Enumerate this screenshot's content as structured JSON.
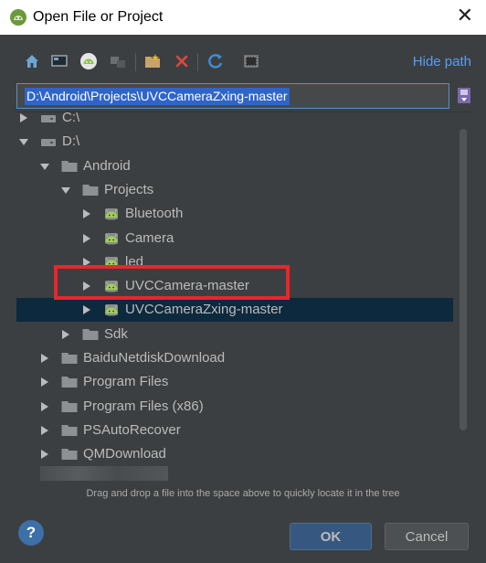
{
  "window": {
    "title": "Open File or Project",
    "close_glyph": "✕"
  },
  "toolbar": {
    "buttons": [
      {
        "name": "home-icon"
      },
      {
        "name": "desktop-icon"
      },
      {
        "name": "project-icon"
      },
      {
        "name": "module-icon"
      },
      {
        "name": "new-folder-icon"
      },
      {
        "name": "delete-icon"
      },
      {
        "name": "refresh-icon"
      },
      {
        "name": "show-hidden-icon"
      }
    ],
    "hide_path_label": "Hide path"
  },
  "path_field": {
    "value": "D:\\Android\\Projects\\UVCCameraZxing-master"
  },
  "tree": {
    "rows": [
      {
        "label": "C:\\",
        "depth": 1,
        "icon": "drive-icon",
        "arrow": "right",
        "selected": false
      },
      {
        "label": "D:\\",
        "depth": 1,
        "icon": "drive-icon",
        "arrow": "down",
        "selected": false
      },
      {
        "label": "Android",
        "depth": 2,
        "icon": "folder-icon",
        "arrow": "down",
        "selected": false
      },
      {
        "label": "Projects",
        "depth": 3,
        "icon": "folder-icon",
        "arrow": "down",
        "selected": false
      },
      {
        "label": "Bluetooth",
        "depth": 4,
        "icon": "android-project-icon",
        "arrow": "right",
        "selected": false
      },
      {
        "label": "Camera",
        "depth": 4,
        "icon": "android-project-icon",
        "arrow": "right",
        "selected": false
      },
      {
        "label": "led",
        "depth": 4,
        "icon": "android-project-icon",
        "arrow": "right",
        "selected": false
      },
      {
        "label": "UVCCamera-master",
        "depth": 4,
        "icon": "android-project-icon",
        "arrow": "right",
        "selected": false
      },
      {
        "label": "UVCCameraZxing-master",
        "depth": 4,
        "icon": "android-project-icon",
        "arrow": "right",
        "selected": true
      },
      {
        "label": "Sdk",
        "depth": 3,
        "icon": "folder-icon",
        "arrow": "right",
        "selected": false
      },
      {
        "label": "BaiduNetdiskDownload",
        "depth": 2,
        "icon": "folder-icon",
        "arrow": "right",
        "selected": false
      },
      {
        "label": "Program Files",
        "depth": 2,
        "icon": "folder-icon",
        "arrow": "right",
        "selected": false
      },
      {
        "label": "Program Files (x86)",
        "depth": 2,
        "icon": "folder-icon",
        "arrow": "right",
        "selected": false
      },
      {
        "label": "PSAutoRecover",
        "depth": 2,
        "icon": "folder-icon",
        "arrow": "right",
        "selected": false
      },
      {
        "label": "QMDownload",
        "depth": 2,
        "icon": "folder-icon",
        "arrow": "right",
        "selected": false
      }
    ]
  },
  "hint": "Drag and drop a file into the space above to quickly locate it in the tree",
  "buttons": {
    "help_label": "?",
    "ok_label": "OK",
    "cancel_label": "Cancel"
  },
  "colors": {
    "background": "#3c3f41",
    "selection": "#0d293e",
    "accent_link": "#589df6",
    "highlight_annotation": "#e8262c",
    "android_green": "#9fcf5a"
  }
}
